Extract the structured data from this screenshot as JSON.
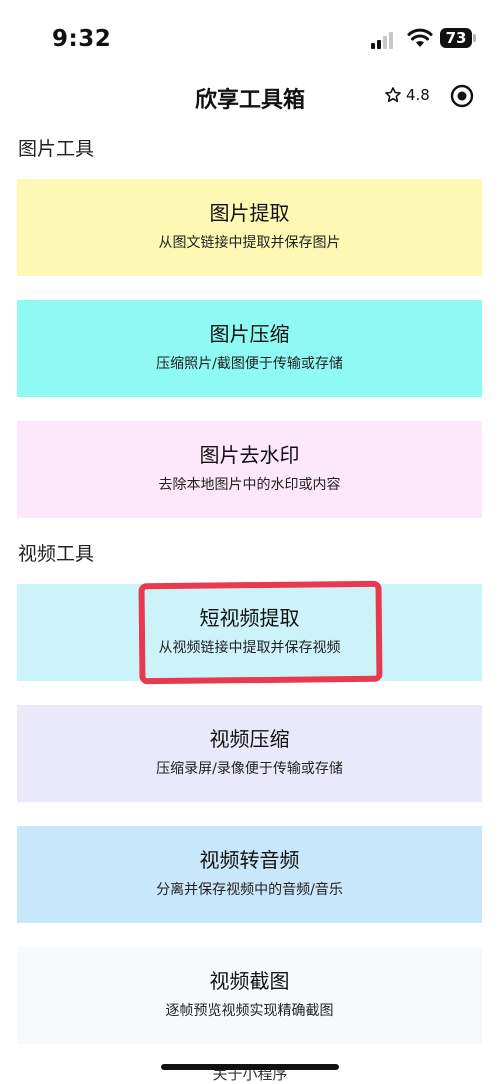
{
  "status_bar": {
    "time": "9:32",
    "battery": "73"
  },
  "nav": {
    "title": "欣享工具箱",
    "rating": "4.8"
  },
  "sections": [
    {
      "title": "图片工具",
      "cards": [
        {
          "title": "图片提取",
          "desc": "从图文链接中提取并保存图片",
          "color": "#fdf8b4"
        },
        {
          "title": "图片压缩",
          "desc": "压缩照片/截图便于传输或存储",
          "color": "#8ffaf3"
        },
        {
          "title": "图片去水印",
          "desc": "去除本地图片中的水印或内容",
          "color": "#fde8fb"
        }
      ]
    },
    {
      "title": "视频工具",
      "cards": [
        {
          "title": "短视频提取",
          "desc": "从视频链接中提取并保存视频",
          "color": "#cdf3fa"
        },
        {
          "title": "视频压缩",
          "desc": "压缩录屏/录像便于传输或存储",
          "color": "#e9e9fb"
        },
        {
          "title": "视频转音频",
          "desc": "分离并保存视频中的音频/音乐",
          "color": "#c9e7fa"
        },
        {
          "title": "视频截图",
          "desc": "逐帧预览视频实现精确截图",
          "color": "#f6fafd"
        }
      ]
    }
  ],
  "footer": {
    "about": "关于小程序"
  },
  "colors": {
    "highlight": "#e8394e"
  }
}
